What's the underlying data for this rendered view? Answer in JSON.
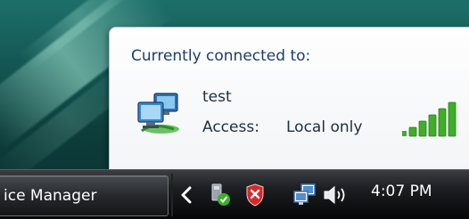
{
  "popup": {
    "title": "Currently connected to:",
    "network_name": "test",
    "access_label": "Access:",
    "access_value": "Local only",
    "icons": {
      "network": "network-computers-icon",
      "signal": "signal-strength-icon"
    },
    "signal_bars_filled": 5,
    "signal_bars_total": 5
  },
  "taskbar": {
    "active_task_label": "ice Manager",
    "tray_icons": [
      "show-hidden-icons-chevron",
      "safely-remove-hardware-icon",
      "security-shield-icon",
      "network-icon",
      "volume-icon"
    ],
    "clock": "4:07 PM"
  },
  "colors": {
    "signal_green": "#3fae28",
    "shield_red": "#d42a2a",
    "popup_title": "#1e3f66"
  }
}
